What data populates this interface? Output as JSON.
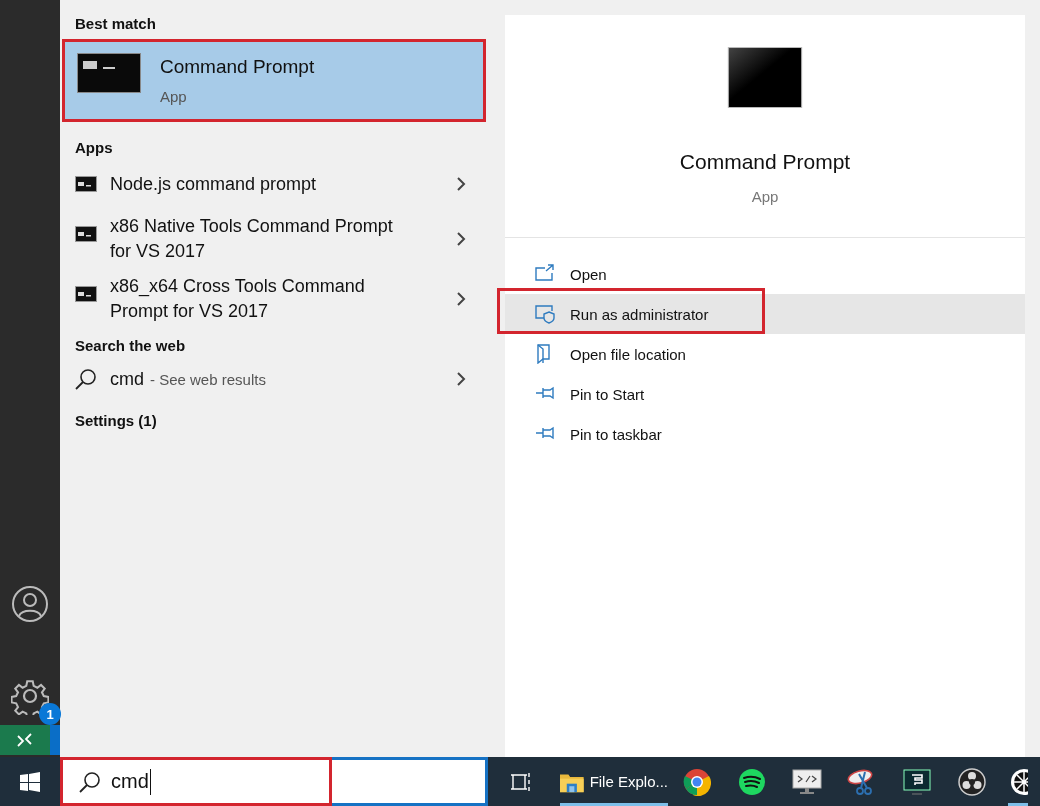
{
  "left_rail": {
    "settings_badge": "1"
  },
  "results": {
    "best_match": {
      "heading": "Best match",
      "title": "Command Prompt",
      "subtitle": "App",
      "selected": true,
      "annotated": true
    },
    "apps": {
      "heading": "Apps",
      "items": [
        {
          "label": "Node.js command prompt"
        },
        {
          "label": "x86 Native Tools Command Prompt for VS 2017"
        },
        {
          "label": "x86_x64 Cross Tools Command Prompt for VS 2017"
        }
      ]
    },
    "web": {
      "heading": "Search the web",
      "query": "cmd",
      "hint": "- See web results"
    },
    "settings": {
      "heading": "Settings (1)"
    }
  },
  "preview": {
    "title": "Command Prompt",
    "subtitle": "App",
    "actions": [
      {
        "kind": "open",
        "label": "Open",
        "highlighted": false,
        "annotated": false
      },
      {
        "kind": "admin",
        "label": "Run as administrator",
        "highlighted": true,
        "annotated": true
      },
      {
        "kind": "folder",
        "label": "Open file location",
        "highlighted": false,
        "annotated": false
      },
      {
        "kind": "pin",
        "label": "Pin to Start",
        "highlighted": false,
        "annotated": false
      },
      {
        "kind": "pin",
        "label": "Pin to taskbar",
        "highlighted": false,
        "annotated": false
      }
    ]
  },
  "taskbar": {
    "search": {
      "value": "cmd",
      "annotated": true
    },
    "items": [
      {
        "kind": "taskview",
        "running": false
      },
      {
        "kind": "explorer",
        "label": "File Explo...",
        "running": true
      },
      {
        "kind": "chrome",
        "running": false
      },
      {
        "kind": "spotify",
        "running": false
      },
      {
        "kind": "monitor",
        "running": false
      },
      {
        "kind": "scissors",
        "running": false
      },
      {
        "kind": "terminal",
        "running": false
      },
      {
        "kind": "obs",
        "running": false
      },
      {
        "kind": "wheel",
        "running": true
      }
    ]
  }
}
